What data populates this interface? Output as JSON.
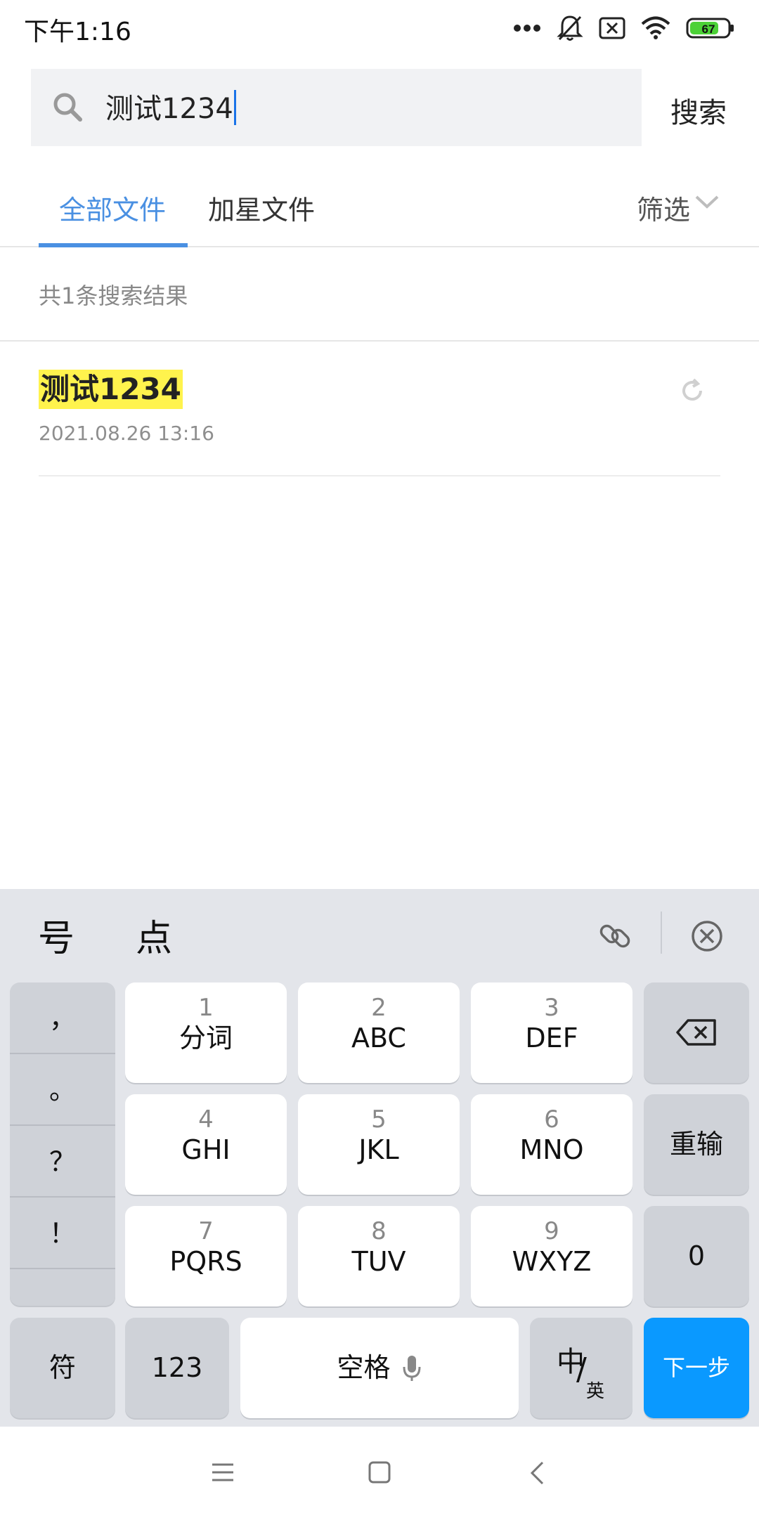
{
  "status_bar": {
    "time": "下午1:16",
    "battery_level": "67",
    "icons": [
      "more-dots-icon",
      "bell-muted-icon",
      "sim-off-icon",
      "wifi-icon",
      "battery-icon"
    ]
  },
  "search": {
    "query": "测试1234",
    "action_label": "搜索"
  },
  "tabs": {
    "all_files": "全部文件",
    "starred_files": "加星文件",
    "filter": "筛选",
    "active": "all_files"
  },
  "results": {
    "count_text": "共1条搜索结果",
    "items": [
      {
        "title": "测试1234",
        "date": "2021.08.26 13:16"
      }
    ]
  },
  "keyboard": {
    "candidates": [
      "号",
      "点"
    ],
    "punctuation": [
      "，",
      "。",
      "？",
      "！"
    ],
    "keys": [
      {
        "num": "1",
        "letters": "分词"
      },
      {
        "num": "2",
        "letters": "ABC"
      },
      {
        "num": "3",
        "letters": "DEF"
      },
      {
        "num": "4",
        "letters": "GHI"
      },
      {
        "num": "5",
        "letters": "JKL"
      },
      {
        "num": "6",
        "letters": "MNO"
      },
      {
        "num": "7",
        "letters": "PQRS"
      },
      {
        "num": "8",
        "letters": "TUV"
      },
      {
        "num": "9",
        "letters": "WXYZ"
      }
    ],
    "retype": "重输",
    "zero": "0",
    "symbols": "符",
    "numbers": "123",
    "space": "空格",
    "lang_main": "中",
    "lang_slash": "/",
    "lang_sub": "英",
    "next": "下一步"
  },
  "colors": {
    "accent": "#4a90e2",
    "highlight": "#fff34d",
    "next_key": "#0a99ff",
    "keyboard_bg": "#e3e5ea"
  }
}
